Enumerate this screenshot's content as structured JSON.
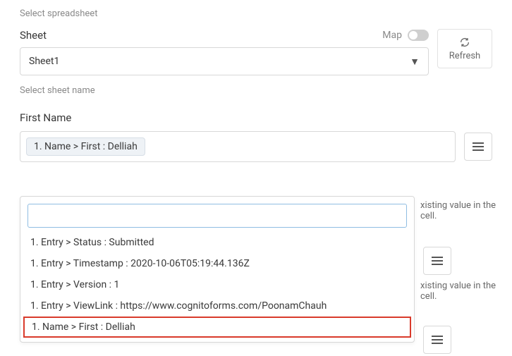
{
  "spreadsheet_help": "Select spreadsheet",
  "sheet": {
    "label": "Sheet",
    "map_label": "Map",
    "value": "Sheet1",
    "help": "Select sheet name"
  },
  "refresh_label": "Refresh",
  "first_name": {
    "label": "First Name",
    "chip": "1. Name > First : Delliah"
  },
  "note_text": "xisting value in the cell.",
  "dropdown": {
    "search_placeholder": "",
    "items": [
      "1. Entry > Status : Submitted",
      "1. Entry > Timestamp : 2020-10-06T05:19:44.136Z",
      "1. Entry > Version : 1",
      "1. Entry > ViewLink : https://www.cognitoforms.com/PoonamChauh",
      "1. Name > First : Delliah"
    ],
    "highlight_index": 4
  }
}
